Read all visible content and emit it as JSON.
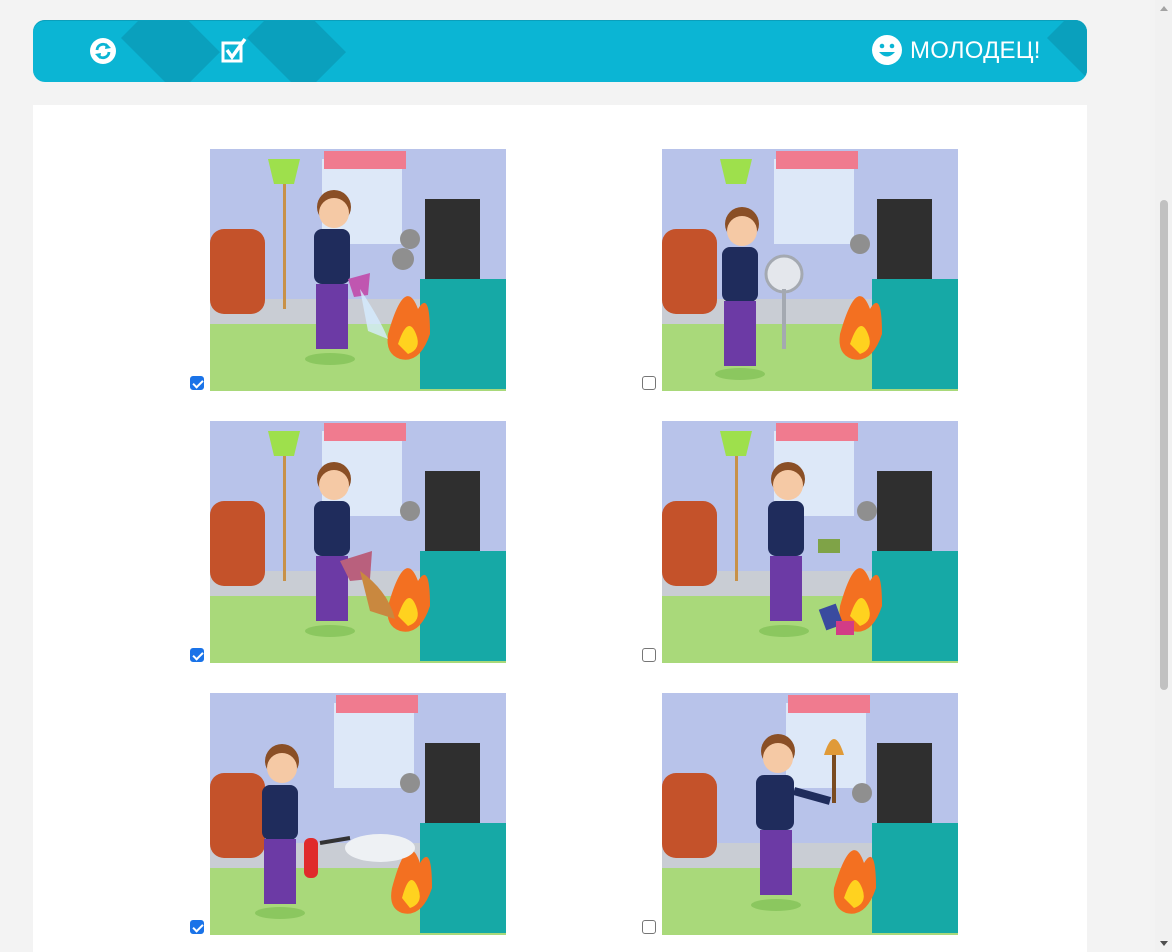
{
  "toolbar": {
    "reload_icon": "reload-icon",
    "check_icon": "checkbox-check-icon",
    "smile_icon": "smiley-icon",
    "result_text": "МОЛОДЕЦ!",
    "color": "#0bb5d4"
  },
  "cards": [
    {
      "action": "pouring-water",
      "checked": true
    },
    {
      "action": "fan",
      "checked": false
    },
    {
      "action": "pouring-sand",
      "checked": true
    },
    {
      "action": "throwing-books",
      "checked": false
    },
    {
      "action": "fire-extinguisher",
      "checked": true
    },
    {
      "action": "broom",
      "checked": false
    }
  ]
}
